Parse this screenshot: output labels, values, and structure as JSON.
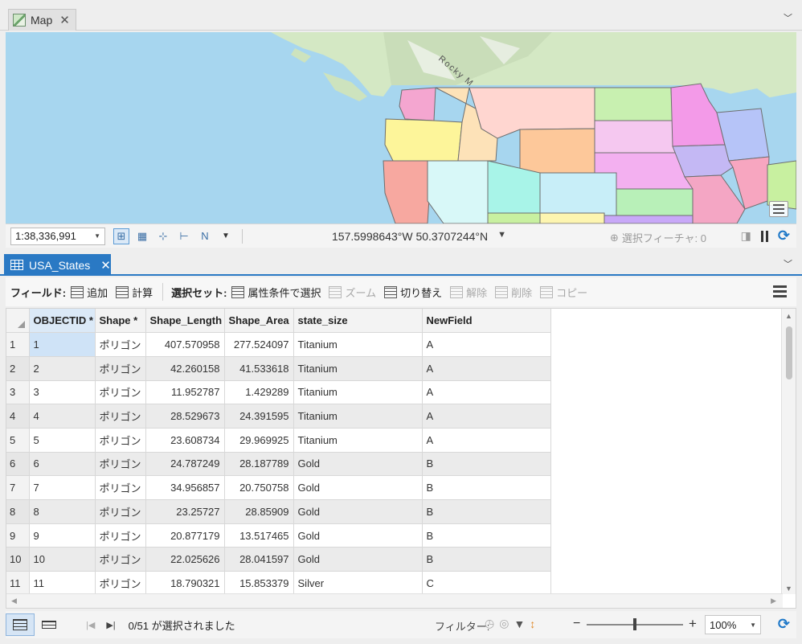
{
  "map_pane": {
    "tab_label": "Map",
    "scale": "1:38,336,991",
    "coordinates": "157.5998643°W 50.3707244°N",
    "selected_features": "選択フィーチャ: 0",
    "map_label": "Rocky M"
  },
  "table_pane": {
    "tab_label": "USA_States",
    "toolbar": {
      "field_label": "フィールド:",
      "add_label": "追加",
      "calculate_label": "計算",
      "selection_label": "選択セット:",
      "select_by_attr_label": "属性条件で選択",
      "zoom_label": "ズーム",
      "switch_label": "切り替え",
      "clear_label": "解除",
      "delete_label": "削除",
      "copy_label": "コピー"
    },
    "columns": [
      "OBJECTID *",
      "Shape *",
      "Shape_Length",
      "Shape_Area",
      "state_size",
      "NewField"
    ],
    "rows": [
      {
        "n": "1",
        "oid": "1",
        "shape": "ポリゴン",
        "len": "407.570958",
        "area": "277.524097",
        "size": "Titanium",
        "nf": "A"
      },
      {
        "n": "2",
        "oid": "2",
        "shape": "ポリゴン",
        "len": "42.260158",
        "area": "41.533618",
        "size": "Titanium",
        "nf": "A"
      },
      {
        "n": "3",
        "oid": "3",
        "shape": "ポリゴン",
        "len": "11.952787",
        "area": "1.429289",
        "size": "Titanium",
        "nf": "A"
      },
      {
        "n": "4",
        "oid": "4",
        "shape": "ポリゴン",
        "len": "28.529673",
        "area": "24.391595",
        "size": "Titanium",
        "nf": "A"
      },
      {
        "n": "5",
        "oid": "5",
        "shape": "ポリゴン",
        "len": "23.608734",
        "area": "29.969925",
        "size": "Titanium",
        "nf": "A"
      },
      {
        "n": "6",
        "oid": "6",
        "shape": "ポリゴン",
        "len": "24.787249",
        "area": "28.187789",
        "size": "Gold",
        "nf": "B"
      },
      {
        "n": "7",
        "oid": "7",
        "shape": "ポリゴン",
        "len": "34.956857",
        "area": "20.750758",
        "size": "Gold",
        "nf": "B"
      },
      {
        "n": "8",
        "oid": "8",
        "shape": "ポリゴン",
        "len": "23.25727",
        "area": "28.85909",
        "size": "Gold",
        "nf": "B"
      },
      {
        "n": "9",
        "oid": "9",
        "shape": "ポリゴン",
        "len": "20.877179",
        "area": "13.517465",
        "size": "Gold",
        "nf": "B"
      },
      {
        "n": "10",
        "oid": "10",
        "shape": "ポリゴン",
        "len": "22.025626",
        "area": "28.041597",
        "size": "Gold",
        "nf": "B"
      },
      {
        "n": "11",
        "oid": "11",
        "shape": "ポリゴン",
        "len": "18.790321",
        "area": "15.853379",
        "size": "Silver",
        "nf": "C"
      }
    ],
    "status": {
      "selection_count": "0/51 が選択されました",
      "filter_label": "フィルター:",
      "zoom_percent": "100%"
    }
  },
  "colors": {
    "accent": "#2a79c4",
    "water": "#a7d6ef"
  }
}
